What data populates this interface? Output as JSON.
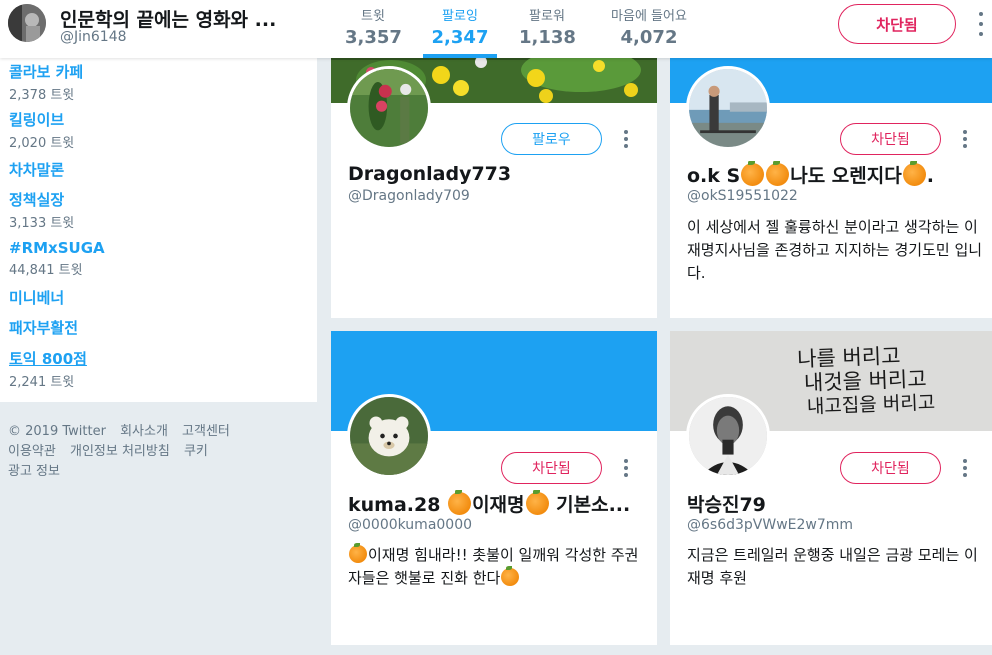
{
  "header": {
    "profile_name": "인문학의 끝에는 영화와 ...",
    "profile_handle": "@Jin6148",
    "stats": [
      {
        "label": "트윗",
        "value": "3,357"
      },
      {
        "label": "팔로잉",
        "value": "2,347"
      },
      {
        "label": "팔로워",
        "value": "1,138"
      },
      {
        "label": "마음에 들어요",
        "value": "4,072"
      }
    ],
    "active_stat": "팔로잉",
    "blocked_label": "차단됨"
  },
  "trends": [
    {
      "name": "콜라보 카페",
      "count": "2,378 트윗"
    },
    {
      "name": "킬링이브",
      "count": "2,020 트윗"
    },
    {
      "name": "차차말론",
      "count": ""
    },
    {
      "name": "정책실장",
      "count": "3,133 트윗"
    },
    {
      "name": "#RMxSUGA",
      "count": "44,841 트윗"
    },
    {
      "name": "미니베너",
      "count": ""
    },
    {
      "name": "패자부활전",
      "count": ""
    },
    {
      "name": "토익 800점",
      "count": "2,241 트윗"
    }
  ],
  "footer": {
    "line1": [
      "© 2019 Twitter",
      "회사소개",
      "고객센터"
    ],
    "line2": [
      "이용약관",
      "개인정보 처리방침",
      "쿠키"
    ],
    "line3": [
      "광고 정보"
    ]
  },
  "cards": [
    {
      "name": "Dragonlady773",
      "handle": "@Dragonlady709",
      "button": "팔로우",
      "bio": ""
    },
    {
      "name_parts": [
        "o.k S",
        "나도 오렌지다",
        "."
      ],
      "handle": "@okS19551022",
      "button": "차단됨",
      "bio": "이 세상에서 젤 훌륭하신 분이라고 생각하는 이재명지사님을 존경하고 지지하는 경기도민 입니다."
    },
    {
      "name_parts": [
        "kuma.28 ",
        "이재명",
        " 기본소..."
      ],
      "handle": "@0000kuma0000",
      "button": "차단됨",
      "bio_parts": [
        "이재명 힘내라!! 촛불이 일깨워 각성한 주권자들은 햇불로 진화 한다"
      ]
    },
    {
      "name": "박승진79",
      "handle": "@6s6d3pVWwE2w7mm",
      "button": "차단됨",
      "bio": "지금은 트레일러 운행중 내일은 금광 모레는 이재명 후원",
      "banner_text": [
        "나를 버리고",
        "내것을 버리고",
        "내고집을 버리고"
      ]
    }
  ],
  "colors": {
    "accent": "#1da1f2",
    "blocked": "#e0245e",
    "background": "#e6ecf0"
  }
}
